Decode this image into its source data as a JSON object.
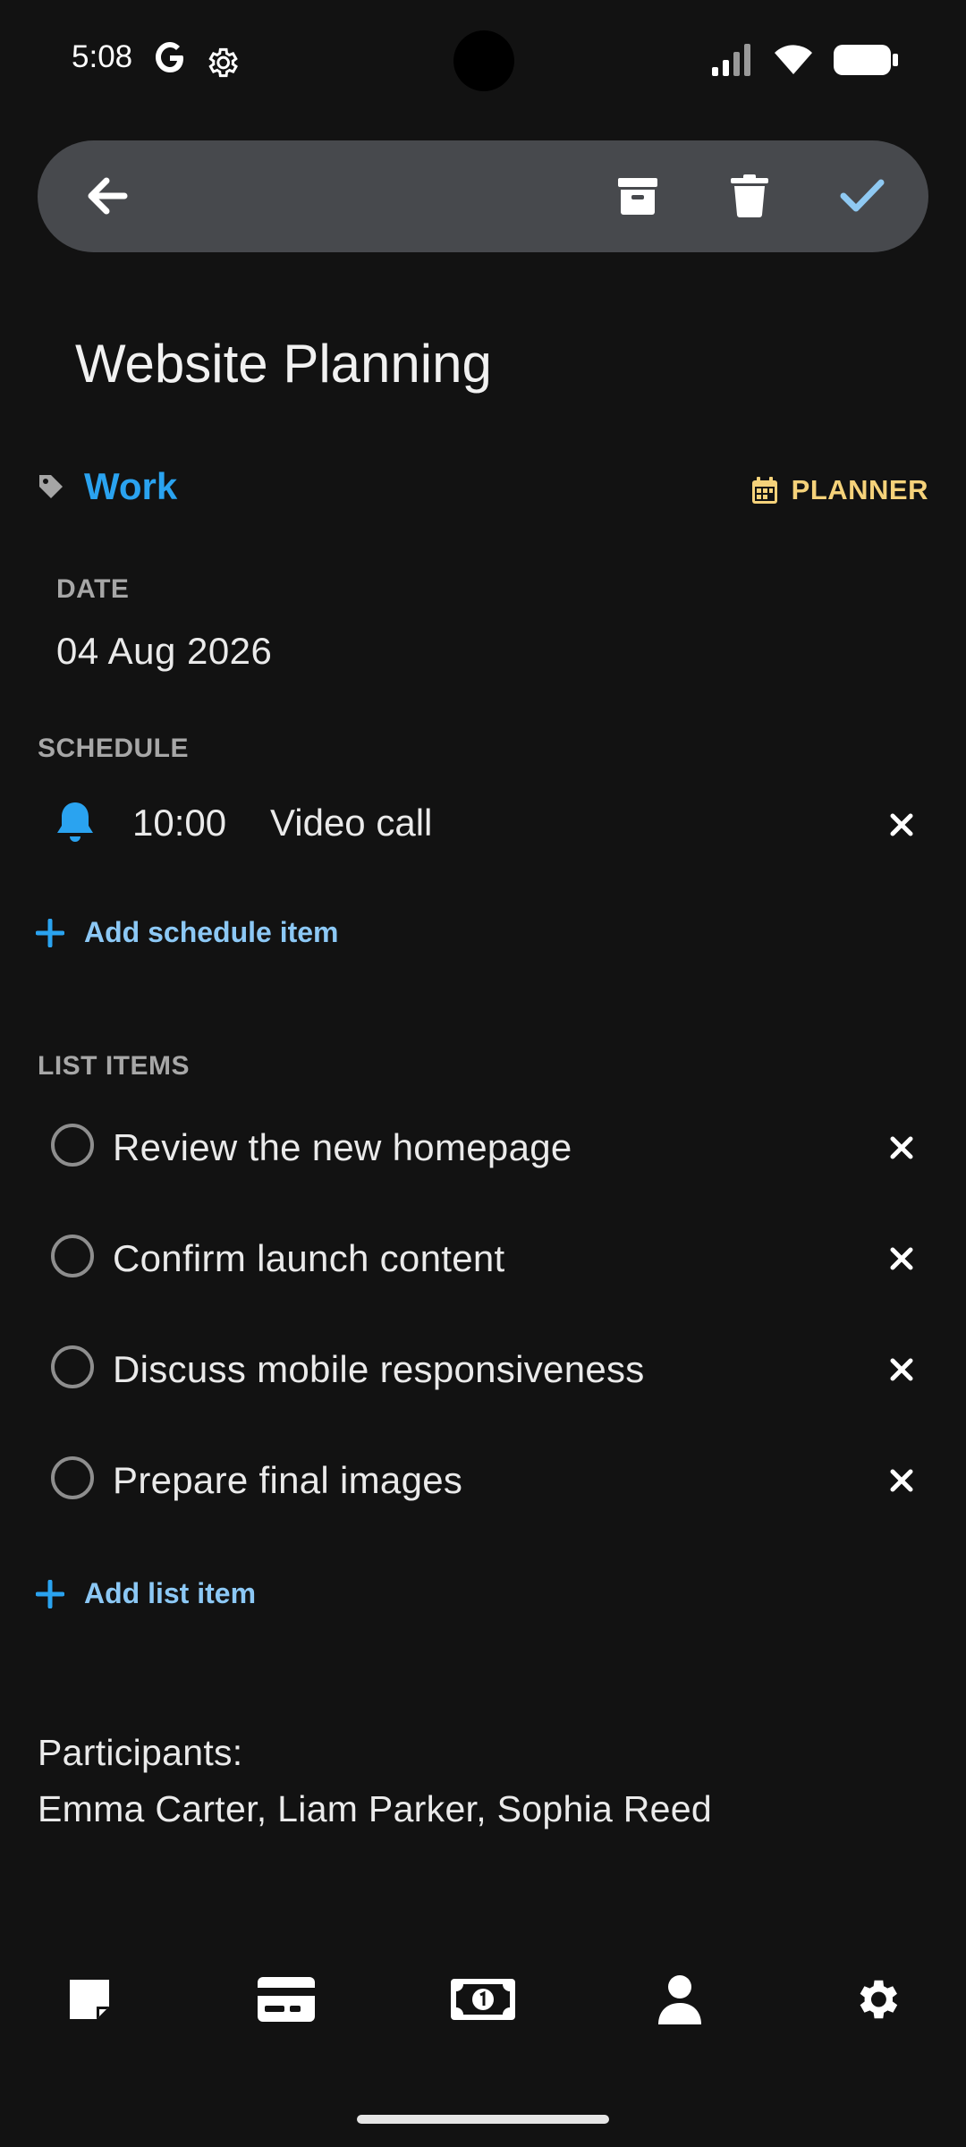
{
  "status_bar": {
    "time": "5:08"
  },
  "toolbar": {
    "icons": [
      "back-arrow-icon",
      "archive-icon",
      "trash-icon",
      "checkmark-icon"
    ]
  },
  "note": {
    "title": "Website Planning",
    "tag": "Work",
    "planner_label": "PLANNER"
  },
  "date_section": {
    "label": "DATE",
    "value": "04 Aug 2026"
  },
  "schedule_section": {
    "label": "SCHEDULE",
    "items": [
      {
        "time": "10:00",
        "text": "Video call"
      }
    ],
    "add_label": "Add schedule item"
  },
  "list_section": {
    "label": "LIST ITEMS",
    "items": [
      {
        "text": "Review the new homepage",
        "checked": false
      },
      {
        "text": "Confirm launch content",
        "checked": false
      },
      {
        "text": "Discuss mobile responsiveness",
        "checked": false
      },
      {
        "text": "Prepare final images",
        "checked": false
      }
    ],
    "add_label": "Add list item"
  },
  "participants": {
    "label": "Participants:",
    "names": "Emma Carter, Liam Parker, Sophia Reed"
  },
  "bottom_nav": {
    "icons": [
      "note-icon",
      "card-icon",
      "money-icon",
      "person-icon",
      "gear-icon"
    ]
  },
  "colors": {
    "background": "#121212",
    "toolbar": "#47494d",
    "accent_blue": "#2aa3f0",
    "link_blue": "#8cc8f5",
    "planner_yellow": "#f5d27a",
    "check_blue": "#8fc9f2"
  }
}
